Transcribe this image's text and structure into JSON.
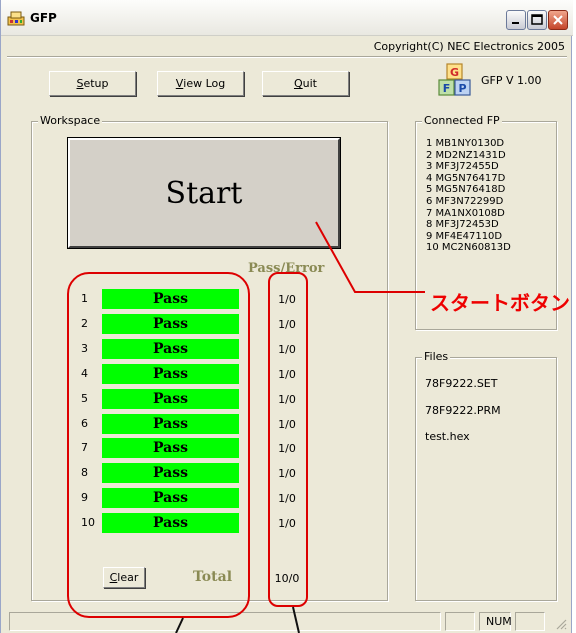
{
  "window": {
    "title": "GFP"
  },
  "header": {
    "copyright": "Copyright(C) NEC Electronics 2005",
    "version": "GFP V 1.00"
  },
  "toolbar": {
    "setup": {
      "underlined": "S",
      "rest": "etup"
    },
    "view_log": {
      "underlined": "V",
      "rest": "iew Log"
    },
    "quit": {
      "underlined": "Q",
      "rest": "uit"
    }
  },
  "workspace": {
    "label": "Workspace",
    "start_label": "Start",
    "pass_error_header": "Pass/Error",
    "rows": [
      {
        "num": "1",
        "status": "Pass",
        "count": "1/0"
      },
      {
        "num": "2",
        "status": "Pass",
        "count": "1/0"
      },
      {
        "num": "3",
        "status": "Pass",
        "count": "1/0"
      },
      {
        "num": "4",
        "status": "Pass",
        "count": "1/0"
      },
      {
        "num": "5",
        "status": "Pass",
        "count": "1/0"
      },
      {
        "num": "6",
        "status": "Pass",
        "count": "1/0"
      },
      {
        "num": "7",
        "status": "Pass",
        "count": "1/0"
      },
      {
        "num": "8",
        "status": "Pass",
        "count": "1/0"
      },
      {
        "num": "9",
        "status": "Pass",
        "count": "1/0"
      },
      {
        "num": "10",
        "status": "Pass",
        "count": "1/0"
      }
    ],
    "clear": {
      "underlined": "C",
      "rest": "lear"
    },
    "total_label": "Total",
    "total_count": "10/0"
  },
  "connected_fp": {
    "label": "Connected FP",
    "items": [
      "1 MB1NY0130D",
      "2 MD2NZ1431D",
      "3 MF3J72455D",
      "4 MG5N76417D",
      "5 MG5N76418D",
      "6 MF3N72299D",
      "7 MA1NX0108D",
      "8 MF3J72453D",
      "9 MF4E47110D",
      "10 MC2N60813D"
    ]
  },
  "files": {
    "label": "Files",
    "items": [
      "78F9222.SET",
      "78F9222.PRM",
      "test.hex"
    ]
  },
  "statusbar": {
    "num": "NUM"
  },
  "annotation": {
    "start_button_label": "スタートボタン"
  },
  "colors": {
    "pass_fill": "#00ff00",
    "annotation_red": "#dd0000",
    "header_olive": "#8a8a54",
    "window_bg": "#ece9d8"
  },
  "icons": [
    "app-icon",
    "minimize-icon",
    "maximize-icon",
    "close-icon",
    "gfp-logo-icon"
  ]
}
